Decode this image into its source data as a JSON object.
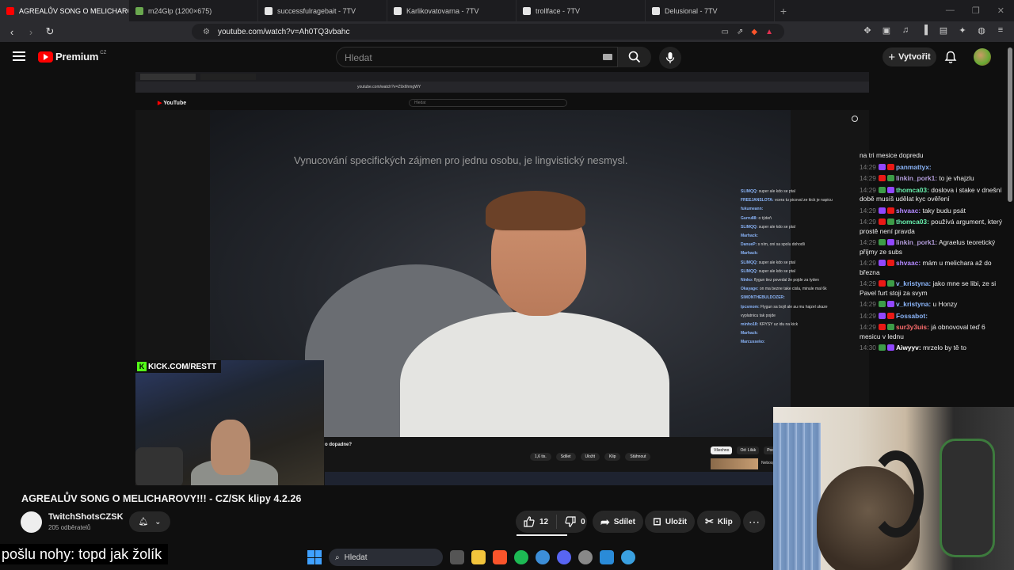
{
  "browser": {
    "tabs": [
      {
        "label": "AGREALŮV SONG O MELICHAROV",
        "active": true,
        "color": "#ff0000"
      },
      {
        "label": "m24Glp (1200×675)",
        "active": false,
        "color": "#6aa84f"
      },
      {
        "label": "successfulragebait - 7TV",
        "active": false,
        "color": "#e5e5e5"
      },
      {
        "label": "Karlikovatovarna - 7TV",
        "active": false,
        "color": "#e5e5e5"
      },
      {
        "label": "trollface - 7TV",
        "active": false,
        "color": "#e5e5e5"
      },
      {
        "label": "Delusional - 7TV",
        "active": false,
        "color": "#e5e5e5"
      }
    ],
    "url": "youtube.com/watch?v=Ah0TQ3vbahc"
  },
  "youtube": {
    "brand": "Premium",
    "region": "CZ",
    "search_placeholder": "Hledat",
    "create_label": "Vytvořit"
  },
  "video": {
    "caption_text": "Vynucování specifických zájmen pro jednu osobu, je lingvistický nesmysl.",
    "inner_url": "youtube.com/watch?v=Z9x6hmgWY",
    "inner_search": "Hledat",
    "inner_title": "o dopadne?",
    "inner_actions": [
      "1,6 tis.",
      "Sdílet",
      "Uložit",
      "Klip",
      "Stáhnout"
    ],
    "inner_filters": [
      "Všechno",
      "Od: Lilák",
      "Podobné"
    ],
    "inner_related": "Nebosp...",
    "overlay_chat": [
      {
        "user": "SLIMQQ:",
        "text": "super ale kdo se ptal"
      },
      {
        "user": "FREEJANSLOTA:",
        "text": "vcera tu picoval ze kick je napicu"
      },
      {
        "user": "fukumeann:",
        "text": ""
      },
      {
        "user": "Gurru88:",
        "text": "o týdeň"
      },
      {
        "user": "SLIMQQ:",
        "text": "super ale kdo se ptal"
      },
      {
        "user": "Marhack:",
        "text": ""
      },
      {
        "user": "DanueP:",
        "text": "s ním, oni sa spolu dohodli"
      },
      {
        "user": "Marhack:",
        "text": ""
      },
      {
        "user": "SLIMQQ:",
        "text": "super ale kdo se ptal"
      },
      {
        "user": "SLIMQQ:",
        "text": "super ale kdo se ptal"
      },
      {
        "user": "Ninko:",
        "text": "flygun tiez povedal že pojde za tyden"
      },
      {
        "user": "Okayage:",
        "text": "on ma bezne take cisla, minule mal 6k"
      },
      {
        "user": "SIMONTHEBULDOZER:",
        "text": ""
      },
      {
        "user": "lpcsmom:",
        "text": "Flygun sa bojil ale au mu hajzel ukaze vyplatnicu tak pojde"
      },
      {
        "user": "minho18:",
        "text": "KRYSY uz idu na kick"
      },
      {
        "user": "Marhack:",
        "text": ""
      },
      {
        "user": "Marcusseko:",
        "text": ""
      }
    ],
    "kick_label": "KICK.COM/RESTT",
    "progress_fraction": 0.24
  },
  "side_chat": [
    {
      "time": "",
      "user": "",
      "text": "na tri mesice dopredu",
      "color": "#ffffff"
    },
    {
      "time": "14:29",
      "user": "panmattyx:",
      "text": "",
      "color": "#8ab4f8"
    },
    {
      "time": "14:29",
      "user": "linkin_pork1:",
      "text": "to je vhajzlu",
      "color": "#b39ddb"
    },
    {
      "time": "14:29",
      "user": "thomca03:",
      "text": "doslova i stake v dnešní době musíš udělat kyc ověření",
      "color": "#69f0ae"
    },
    {
      "time": "14:29",
      "user": "shvaac:",
      "text": "taky budu psát",
      "color": "#b388ff"
    },
    {
      "time": "14:29",
      "user": "thomca03:",
      "text": "používá argument, který prostě není pravda",
      "color": "#69f0ae"
    },
    {
      "time": "14:29",
      "user": "linkin_pork1:",
      "text": "Agraelus teoretický příjmy ze subs",
      "color": "#b39ddb"
    },
    {
      "time": "14:29",
      "user": "shvaac:",
      "text": "mám u melichara až do března",
      "color": "#b388ff"
    },
    {
      "time": "14:29",
      "user": "v_kristyna:",
      "text": "jako mne se libi, ze si Pavel furt stoji za svym",
      "color": "#8ab4f8"
    },
    {
      "time": "14:29",
      "user": "v_kristyna:",
      "text": "u Honzy",
      "color": "#8ab4f8"
    },
    {
      "time": "14:29",
      "user": "Fossabot:",
      "text": "",
      "color": "#8ab4f8"
    },
    {
      "time": "14:29",
      "user": "sur3y3uis:",
      "text": "já obnovoval teď 6 mesicu v lednu",
      "color": "#ff6e6e"
    },
    {
      "time": "14:30",
      "user": "Aiwyyv:",
      "text": "mrzelo by tě to",
      "color": "#ffffff"
    }
  ],
  "video_meta": {
    "title": "AGREALŮV SONG O MELICHAROVY!!! - CZ/SK klipy 4.2.26",
    "channel": "TwitchShotsCZSK",
    "subscribers": "205 odběratelů",
    "likes": "12",
    "dislikes": "0",
    "share_label": "Sdílet",
    "save_label": "Uložit",
    "clip_label": "Klip"
  },
  "subtitle_text": "pošlu nohy: topd jak žolík",
  "taskbar": {
    "search_label": "Hledat"
  },
  "colors": {
    "accent": "#ff0000",
    "kick": "#53fc18",
    "bg": "#0f0f0f"
  }
}
